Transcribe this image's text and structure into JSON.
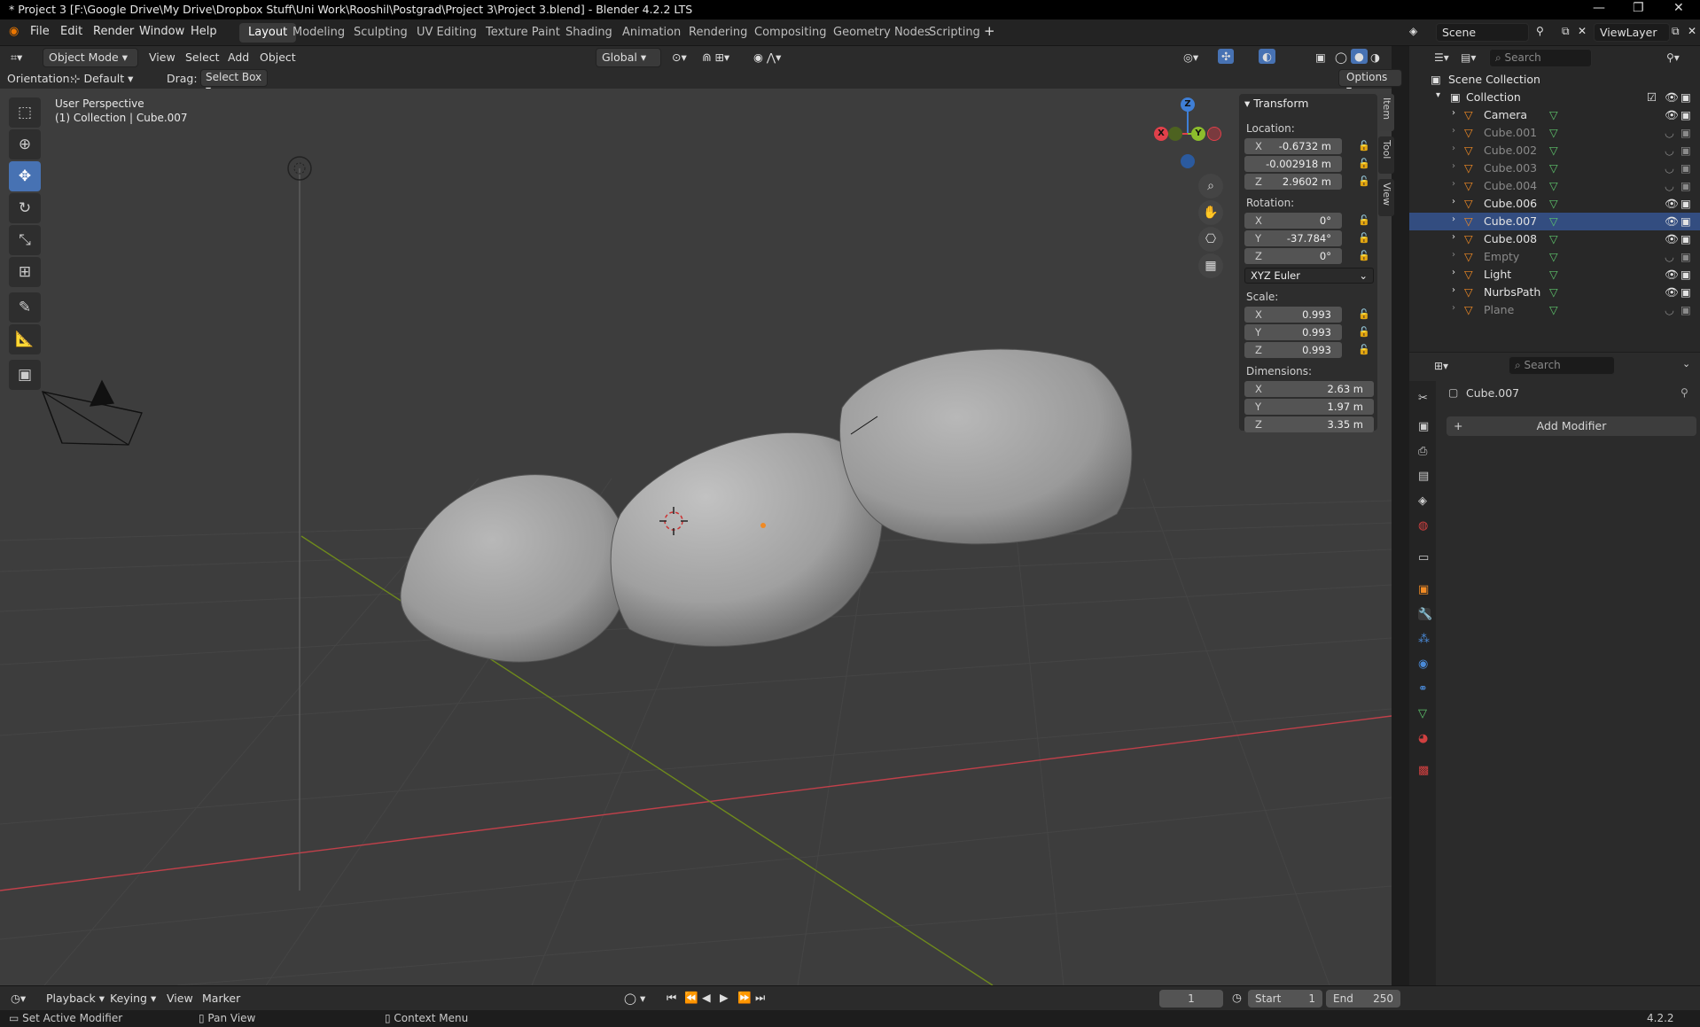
{
  "window": {
    "title": "* Project 3 [F:\\Google Drive\\My Drive\\Dropbox Stuff\\Uni Work\\Rooshil\\Postgrad\\Project 3\\Project 3.blend] - Blender 4.2.2 LTS"
  },
  "menu": [
    "File",
    "Edit",
    "Render",
    "Window",
    "Help"
  ],
  "workspaces": [
    "Layout",
    "Modeling",
    "Sculpting",
    "UV Editing",
    "Texture Paint",
    "Shading",
    "Animation",
    "Rendering",
    "Compositing",
    "Geometry Nodes",
    "Scripting"
  ],
  "active_workspace": "Layout",
  "scene": {
    "name": "Scene",
    "view_layer": "ViewLayer"
  },
  "viewport_header": {
    "mode": "Object Mode",
    "menus": [
      "View",
      "Select",
      "Add",
      "Object"
    ],
    "transform_space": "Global",
    "orientation_label": "Orientation:",
    "orientation_value": "Default",
    "drag_label": "Drag:",
    "drag_value": "Select Box",
    "options": "Options"
  },
  "viewport_overlay": {
    "perspective": "User Perspective",
    "context": "(1) Collection | Cube.007"
  },
  "gizmo": {
    "x": "X",
    "y": "Y",
    "z": "Z"
  },
  "side_tabs": [
    "Item",
    "Tool",
    "View"
  ],
  "transform_panel": {
    "title": "Transform",
    "location_label": "Location:",
    "location": [
      {
        "axis": "X",
        "value": "-0.6732 m"
      },
      {
        "axis": "",
        "value": "-0.002918 m"
      },
      {
        "axis": "Z",
        "value": "2.9602 m"
      }
    ],
    "rotation_label": "Rotation:",
    "rotation": [
      {
        "axis": "X",
        "value": "0°"
      },
      {
        "axis": "Y",
        "value": "-37.784°"
      },
      {
        "axis": "Z",
        "value": "0°"
      }
    ],
    "rotation_mode": "XYZ Euler",
    "scale_label": "Scale:",
    "scale": [
      {
        "axis": "X",
        "value": "0.993"
      },
      {
        "axis": "Y",
        "value": "0.993"
      },
      {
        "axis": "Z",
        "value": "0.993"
      }
    ],
    "dimensions_label": "Dimensions:",
    "dimensions": [
      {
        "axis": "X",
        "value": "2.63 m"
      },
      {
        "axis": "Y",
        "value": "1.97 m"
      },
      {
        "axis": "Z",
        "value": "3.35 m"
      }
    ]
  },
  "outliner": {
    "search_placeholder": "Search",
    "root": "Scene Collection",
    "collection": "Collection",
    "items": [
      {
        "name": "Camera",
        "visible": true
      },
      {
        "name": "Cube.001",
        "visible": false
      },
      {
        "name": "Cube.002",
        "visible": false
      },
      {
        "name": "Cube.003",
        "visible": false
      },
      {
        "name": "Cube.004",
        "visible": false
      },
      {
        "name": "Cube.006",
        "visible": true
      },
      {
        "name": "Cube.007",
        "visible": true
      },
      {
        "name": "Cube.008",
        "visible": true
      },
      {
        "name": "Empty",
        "visible": false
      },
      {
        "name": "Light",
        "visible": true
      },
      {
        "name": "NurbsPath",
        "visible": true
      },
      {
        "name": "Plane",
        "visible": false
      }
    ]
  },
  "properties": {
    "search_placeholder": "Search",
    "object_name": "Cube.007",
    "add_modifier": "Add Modifier"
  },
  "timeline": {
    "menus": [
      "Playback",
      "Keying",
      "View",
      "Marker"
    ],
    "current_frame": "1",
    "start_label": "Start",
    "start": "1",
    "end_label": "End",
    "end": "250"
  },
  "statusbar": {
    "left": "Set Active Modifier",
    "middle": "Pan View",
    "right": "Context Menu",
    "version": "4.2.2"
  },
  "colors": {
    "accent": "#4772b3",
    "x_axis": "#e0404a",
    "y_axis": "#8cbc2c",
    "z_axis": "#3f7fd6"
  }
}
